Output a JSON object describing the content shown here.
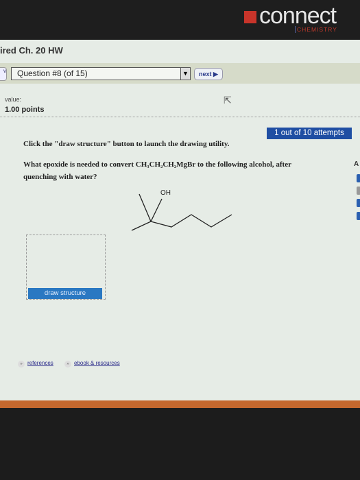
{
  "header": {
    "brand": "connect",
    "subject": "CHEMISTRY"
  },
  "assignment": {
    "title": "ired Ch. 20 HW"
  },
  "nav": {
    "question_select": "Question #8 (of 15)",
    "next_label": "next ▶",
    "prev_label": "v"
  },
  "question": {
    "value_label": "value:",
    "points": "1.00 points",
    "attempts": "1 out of 10 attempts",
    "instruction": "Click the \"draw structure\" button to launch the drawing utility.",
    "prompt_start": "What epoxide is needed to convert ",
    "reagent": "CH₃CH₂CH₂MgBr",
    "prompt_end": " to the following alcohol, after",
    "prompt_line2": "quenching with water?",
    "molecule_label": "OH",
    "draw_button": "draw structure"
  },
  "links": [
    {
      "label": "references"
    },
    {
      "label": "ebook & resources"
    }
  ],
  "right_edge": {
    "letter": "A"
  },
  "colors": {
    "attempts_badge": "#1f4ea3",
    "draw_button": "#2a78c2",
    "footer_bar": "#c4682e",
    "logo_red": "#c8342a"
  }
}
